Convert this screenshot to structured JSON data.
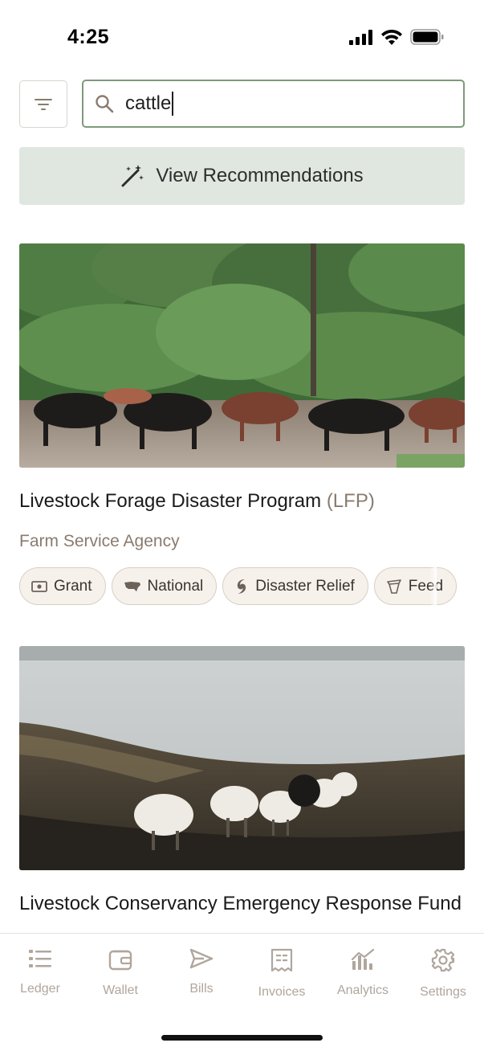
{
  "status_bar": {
    "time": "4:25"
  },
  "search": {
    "filter_icon": "filter-lines-icon",
    "search_icon": "search-icon",
    "value": "cattle"
  },
  "recommendations_button": {
    "label": "View Recommendations",
    "icon": "magic-wand-icon"
  },
  "cards": [
    {
      "title": "Livestock Forage Disaster Program",
      "title_abbr": "(LFP)",
      "agency": "Farm Service Agency",
      "tags": [
        {
          "label": "Grant",
          "icon": "cash-icon"
        },
        {
          "label": "National",
          "icon": "us-map-icon"
        },
        {
          "label": "Disaster Relief",
          "icon": "hurricane-icon"
        },
        {
          "label": "Feed",
          "icon": "feed-icon"
        }
      ]
    },
    {
      "title": "Livestock Conservancy Emergency Response Fund"
    }
  ],
  "tab_bar": {
    "tabs": [
      {
        "label": "Ledger",
        "icon": "ledger-list-icon"
      },
      {
        "label": "Wallet",
        "icon": "wallet-icon"
      },
      {
        "label": "Bills",
        "icon": "send-icon"
      },
      {
        "label": "Invoices",
        "icon": "receipt-icon"
      },
      {
        "label": "Analytics",
        "icon": "chart-icon"
      },
      {
        "label": "Settings",
        "icon": "gear-icon"
      }
    ]
  },
  "colors": {
    "accent_green": "#7e9a7b",
    "rec_bg": "#e0e7e0",
    "muted_brown": "#8a7b6e",
    "tag_bg": "#f6f1eb"
  }
}
